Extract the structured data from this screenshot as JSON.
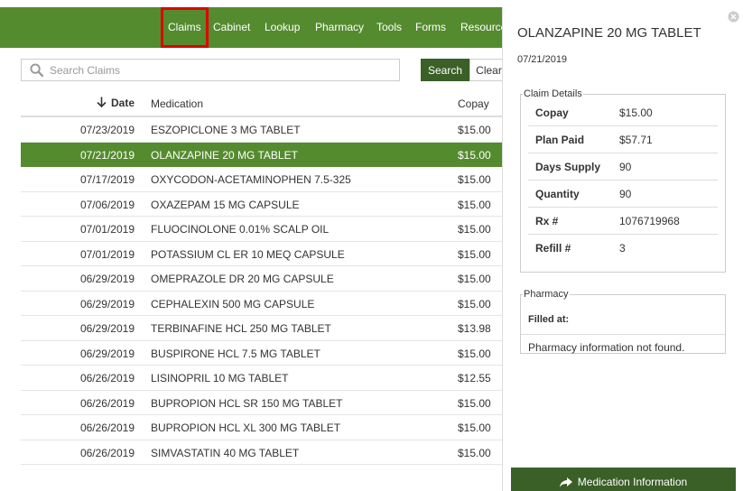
{
  "nav": {
    "tabs": [
      {
        "label": "Claims",
        "active": true
      },
      {
        "label": "Cabinet"
      },
      {
        "label": "Lookup"
      },
      {
        "label": "Pharmacy"
      },
      {
        "label": "Tools"
      },
      {
        "label": "Forms"
      },
      {
        "label": "Resources"
      }
    ]
  },
  "search": {
    "placeholder": "Search Claims",
    "search_label": "Search",
    "clear_label": "Clear"
  },
  "table": {
    "headers": {
      "date": "Date",
      "medication": "Medication",
      "copay": "Copay"
    },
    "sort_icon": "arrow-down-icon",
    "rows": [
      {
        "date": "07/23/2019",
        "medication": "ESZOPICLONE 3 MG TABLET",
        "copay": "$15.00"
      },
      {
        "date": "07/21/2019",
        "medication": "OLANZAPINE 20 MG TABLET",
        "copay": "$15.00",
        "selected": true
      },
      {
        "date": "07/17/2019",
        "medication": "OXYCODON-ACETAMINOPHEN 7.5-325",
        "copay": "$15.00"
      },
      {
        "date": "07/06/2019",
        "medication": "OXAZEPAM 15 MG CAPSULE",
        "copay": "$15.00"
      },
      {
        "date": "07/01/2019",
        "medication": "FLUOCINOLONE 0.01% SCALP OIL",
        "copay": "$15.00"
      },
      {
        "date": "07/01/2019",
        "medication": "POTASSIUM CL ER 10 MEQ CAPSULE",
        "copay": "$15.00"
      },
      {
        "date": "06/29/2019",
        "medication": "OMEPRAZOLE DR 20 MG CAPSULE",
        "copay": "$15.00"
      },
      {
        "date": "06/29/2019",
        "medication": "CEPHALEXIN 500 MG CAPSULE",
        "copay": "$15.00"
      },
      {
        "date": "06/29/2019",
        "medication": "TERBINAFINE HCL 250 MG TABLET",
        "copay": "$13.98"
      },
      {
        "date": "06/29/2019",
        "medication": "BUSPIRONE HCL 7.5 MG TABLET",
        "copay": "$15.00"
      },
      {
        "date": "06/26/2019",
        "medication": "LISINOPRIL 10 MG TABLET",
        "copay": "$12.55"
      },
      {
        "date": "06/26/2019",
        "medication": "BUPROPION HCL SR 150 MG TABLET",
        "copay": "$15.00"
      },
      {
        "date": "06/26/2019",
        "medication": "BUPROPION HCL XL 300 MG TABLET",
        "copay": "$15.00"
      },
      {
        "date": "06/26/2019",
        "medication": "SIMVASTATIN 40 MG TABLET",
        "copay": "$15.00"
      }
    ]
  },
  "detail": {
    "title": "OLANZAPINE 20 MG TABLET",
    "date": "07/21/2019",
    "claim_legend": "Claim Details",
    "claim_rows": [
      {
        "label": "Copay",
        "value": "$15.00"
      },
      {
        "label": "Plan Paid",
        "value": "$57.71"
      },
      {
        "label": "Days Supply",
        "value": "90"
      },
      {
        "label": "Quantity",
        "value": "90"
      },
      {
        "label": "Rx #",
        "value": "1076719968"
      },
      {
        "label": "Refill #",
        "value": "3"
      }
    ],
    "pharmacy_legend": "Pharmacy",
    "filled_at": "Filled at:",
    "pharmacy_text": "Pharmacy information not found.",
    "med_info_label": "Medication Information"
  },
  "colors": {
    "brand_green": "#558b2f",
    "dark_green": "#3a5f27",
    "active_outline": "#e00000"
  }
}
